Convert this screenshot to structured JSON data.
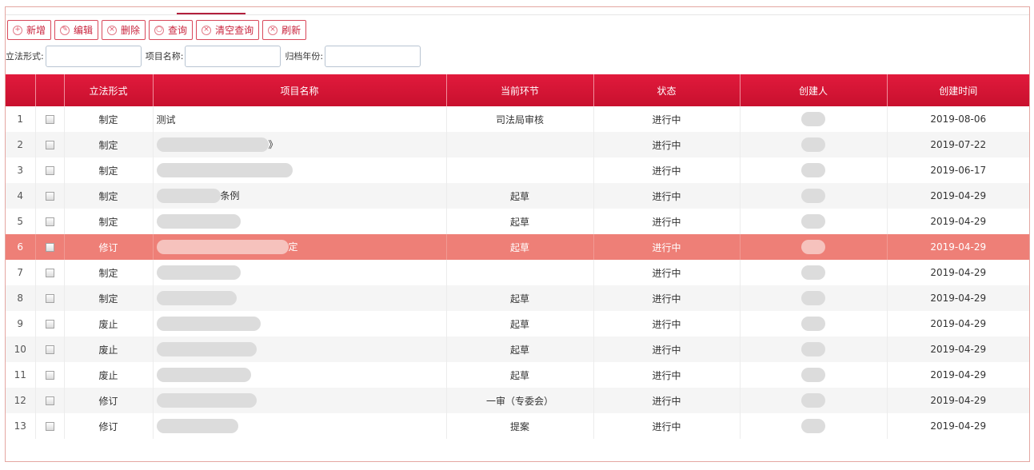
{
  "toolbar": {
    "buttons": [
      {
        "label": "新增",
        "icon": "plus-circle-icon",
        "glyph": "+"
      },
      {
        "label": "编辑",
        "icon": "edit-circle-icon",
        "glyph": "✎"
      },
      {
        "label": "删除",
        "icon": "delete-circle-icon",
        "glyph": "×"
      },
      {
        "label": "查询",
        "icon": "search-circle-icon",
        "glyph": "○"
      },
      {
        "label": "清空查询",
        "icon": "clear-circle-icon",
        "glyph": "×"
      },
      {
        "label": "刷新",
        "icon": "refresh-circle-icon",
        "glyph": "×"
      }
    ]
  },
  "filters": {
    "form_label": "立法形式:",
    "form_value": "",
    "name_label": "项目名称:",
    "name_value": "",
    "year_label": "归档年份:",
    "year_value": ""
  },
  "table": {
    "columns": [
      "立法形式",
      "项目名称",
      "当前环节",
      "状态",
      "创建人",
      "创建时间"
    ],
    "rows": [
      {
        "no": "1",
        "form": "制定",
        "name": "测试",
        "stage": "司法局审核",
        "status": "进行中",
        "date": "2019-08-06"
      },
      {
        "no": "2",
        "form": "制定",
        "name": "》",
        "stage": "",
        "status": "进行中",
        "date": "2019-07-22"
      },
      {
        "no": "3",
        "form": "制定",
        "name": "",
        "stage": "",
        "status": "进行中",
        "date": "2019-06-17"
      },
      {
        "no": "4",
        "form": "制定",
        "name": "条例",
        "stage": "起草",
        "status": "进行中",
        "date": "2019-04-29"
      },
      {
        "no": "5",
        "form": "制定",
        "name": "",
        "stage": "起草",
        "status": "进行中",
        "date": "2019-04-29"
      },
      {
        "no": "6",
        "form": "修订",
        "name": "定",
        "stage": "起草",
        "status": "进行中",
        "date": "2019-04-29",
        "selected": true
      },
      {
        "no": "7",
        "form": "制定",
        "name": "",
        "stage": "",
        "status": "进行中",
        "date": "2019-04-29"
      },
      {
        "no": "8",
        "form": "制定",
        "name": "",
        "stage": "起草",
        "status": "进行中",
        "date": "2019-04-29"
      },
      {
        "no": "9",
        "form": "废止",
        "name": "",
        "stage": "起草",
        "status": "进行中",
        "date": "2019-04-29"
      },
      {
        "no": "10",
        "form": "废止",
        "name": "",
        "stage": "起草",
        "status": "进行中",
        "date": "2019-04-29"
      },
      {
        "no": "11",
        "form": "废止",
        "name": "",
        "stage": "起草",
        "status": "进行中",
        "date": "2019-04-29"
      },
      {
        "no": "12",
        "form": "修订",
        "name": "",
        "stage": "一审（专委会）",
        "status": "进行中",
        "date": "2019-04-29"
      },
      {
        "no": "13",
        "form": "修订",
        "name": "",
        "stage": "提案",
        "status": "进行中",
        "date": "2019-04-29"
      }
    ]
  },
  "colors": {
    "header_red": "#d2142f",
    "selected_row": "#ee7f77",
    "button_red": "#c9243d"
  }
}
